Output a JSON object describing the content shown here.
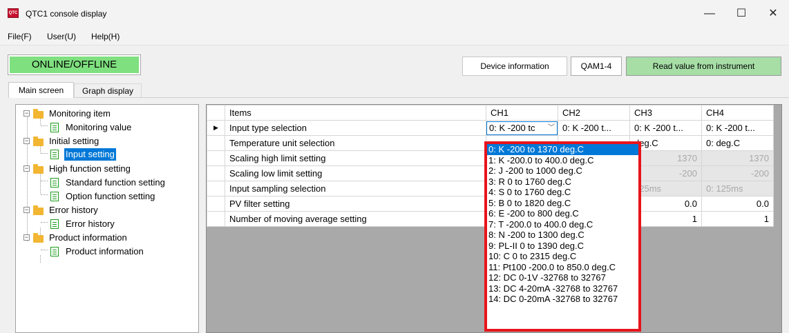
{
  "window": {
    "title": "QTC1 console display",
    "minimize": "—",
    "maximize": "☐",
    "close": "✕",
    "icon_text": "QTC"
  },
  "menu": [
    "File(F)",
    "User(U)",
    "Help(H)"
  ],
  "toolbar": {
    "online_offline": "ONLINE/OFFLINE",
    "device_info_label": "Device information",
    "device_info_value": "QAM1-4",
    "read_button": "Read value from instrument",
    "colors": {
      "online": "#7fe07f",
      "read": "#a6dea6"
    }
  },
  "tabs": [
    "Main screen",
    "Graph display"
  ],
  "tree": [
    {
      "label": "Monitoring item",
      "children": [
        "Monitoring value"
      ]
    },
    {
      "label": "Initial setting",
      "children": [
        "Input setting"
      ]
    },
    {
      "label": "High function setting",
      "children": [
        "Standard function setting",
        "Option function setting"
      ]
    },
    {
      "label": "Error history",
      "children": [
        "Error history"
      ]
    },
    {
      "label": "Product information",
      "children": [
        "Product information"
      ]
    }
  ],
  "table": {
    "headers": [
      "Items",
      "CH1",
      "CH2",
      "CH3",
      "CH4"
    ],
    "rows": [
      {
        "item": "Input type selection",
        "ch": [
          "0: K -200 tc",
          "0: K -200 t...",
          "0: K -200 t...",
          "0: K -200 t..."
        ]
      },
      {
        "item": "Temperature unit selection",
        "ch": [
          "",
          "",
          "deg.C",
          "0: deg.C"
        ]
      },
      {
        "item": "Scaling high limit setting",
        "ch": [
          "",
          "",
          "1370",
          "1370"
        ]
      },
      {
        "item": "Scaling low limit setting",
        "ch": [
          "",
          "",
          "-200",
          "-200"
        ]
      },
      {
        "item": "Input sampling selection",
        "ch": [
          "",
          "",
          "125ms",
          "0: 125ms"
        ]
      },
      {
        "item": "PV filter setting",
        "ch": [
          "",
          "",
          "0.0",
          "0.0"
        ]
      },
      {
        "item": "Number of moving average setting",
        "ch": [
          "",
          "",
          "1",
          "1"
        ]
      }
    ]
  },
  "dropdown": {
    "options": [
      "0: K -200 to 1370  deg.C",
      "1: K -200.0 to 400.0 deg.C",
      "2: J -200 to 1000  deg.C",
      "3: R 0 to 1760  deg.C",
      "4: S 0 to 1760  deg.C",
      "5: B 0 to 1820  deg.C",
      "6: E -200 to 800  deg.C",
      "7: T -200.0 to 400.0 deg.C",
      "8: N -200 to 1300  deg.C",
      "9: PL-II 0 to 1390  deg.C",
      "10: C 0 to 2315  deg.C",
      "11: Pt100 -200.0 to 850.0  deg.C",
      "12: DC 0-1V -32768 to 32767",
      "13: DC 4-20mA -32768 to 32767",
      "14: DC 0-20mA -32768 to 32767"
    ],
    "selected_index": 0,
    "highlight_color": "#e8141b"
  }
}
